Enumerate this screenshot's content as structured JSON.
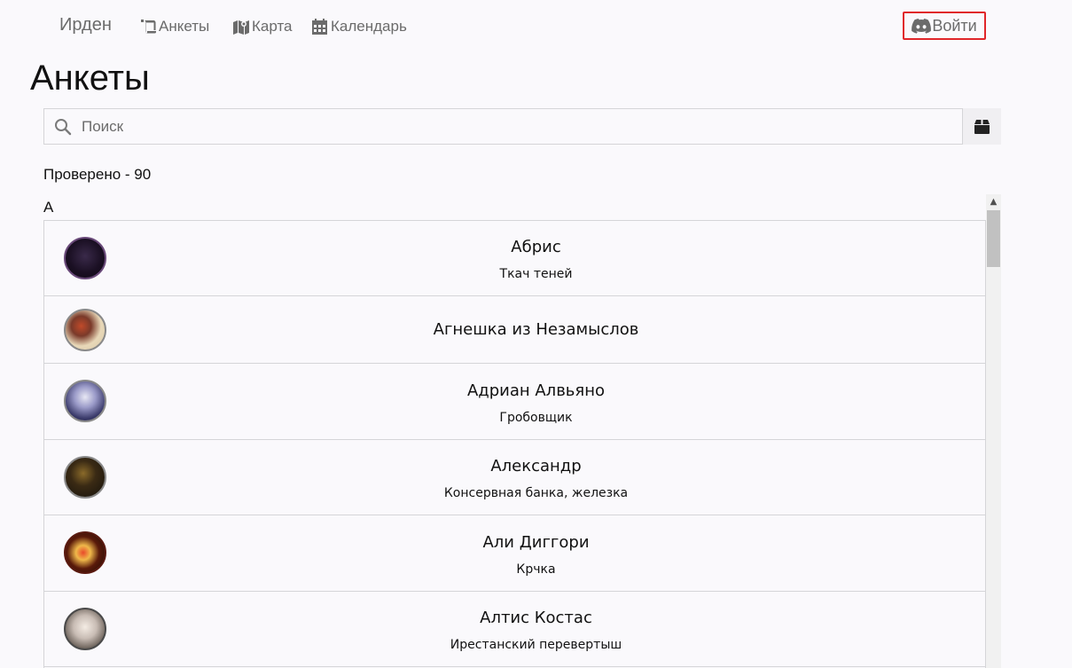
{
  "nav": {
    "brand": "Ирден",
    "links": [
      {
        "label": "Анкеты",
        "icon": "scroll-icon"
      },
      {
        "label": "Карта",
        "icon": "map-icon"
      },
      {
        "label": "Календарь",
        "icon": "calendar-icon"
      }
    ],
    "login_label": "Войти",
    "login_icon": "discord-icon"
  },
  "page": {
    "title": "Анкеты",
    "search_placeholder": "Поиск",
    "checked_label": "Проверено - 90",
    "group_letter": "А"
  },
  "colors": {
    "accent_border": "#e0262a",
    "nav_text": "#6b6b6b",
    "background": "#faf9fc"
  },
  "characters": [
    {
      "name": "Абрис",
      "subtitle": "Ткач теней",
      "avatar": "dark-purple-avatar"
    },
    {
      "name": "Агнешка из Незамыслов",
      "subtitle": "",
      "avatar": "pixel-witch-avatar"
    },
    {
      "name": "Адриан Алвьяно",
      "subtitle": "Гробовщик",
      "avatar": "anime-white-hair-avatar"
    },
    {
      "name": "Александр",
      "subtitle": "Консервная банка, железка",
      "avatar": "dark-armor-avatar"
    },
    {
      "name": "Али Диггори",
      "subtitle": "Крчка",
      "avatar": "pixel-bird-avatar"
    },
    {
      "name": "Алтис Костас",
      "subtitle": "Ирестанский перевертыш",
      "avatar": "anime-elf-avatar"
    }
  ]
}
